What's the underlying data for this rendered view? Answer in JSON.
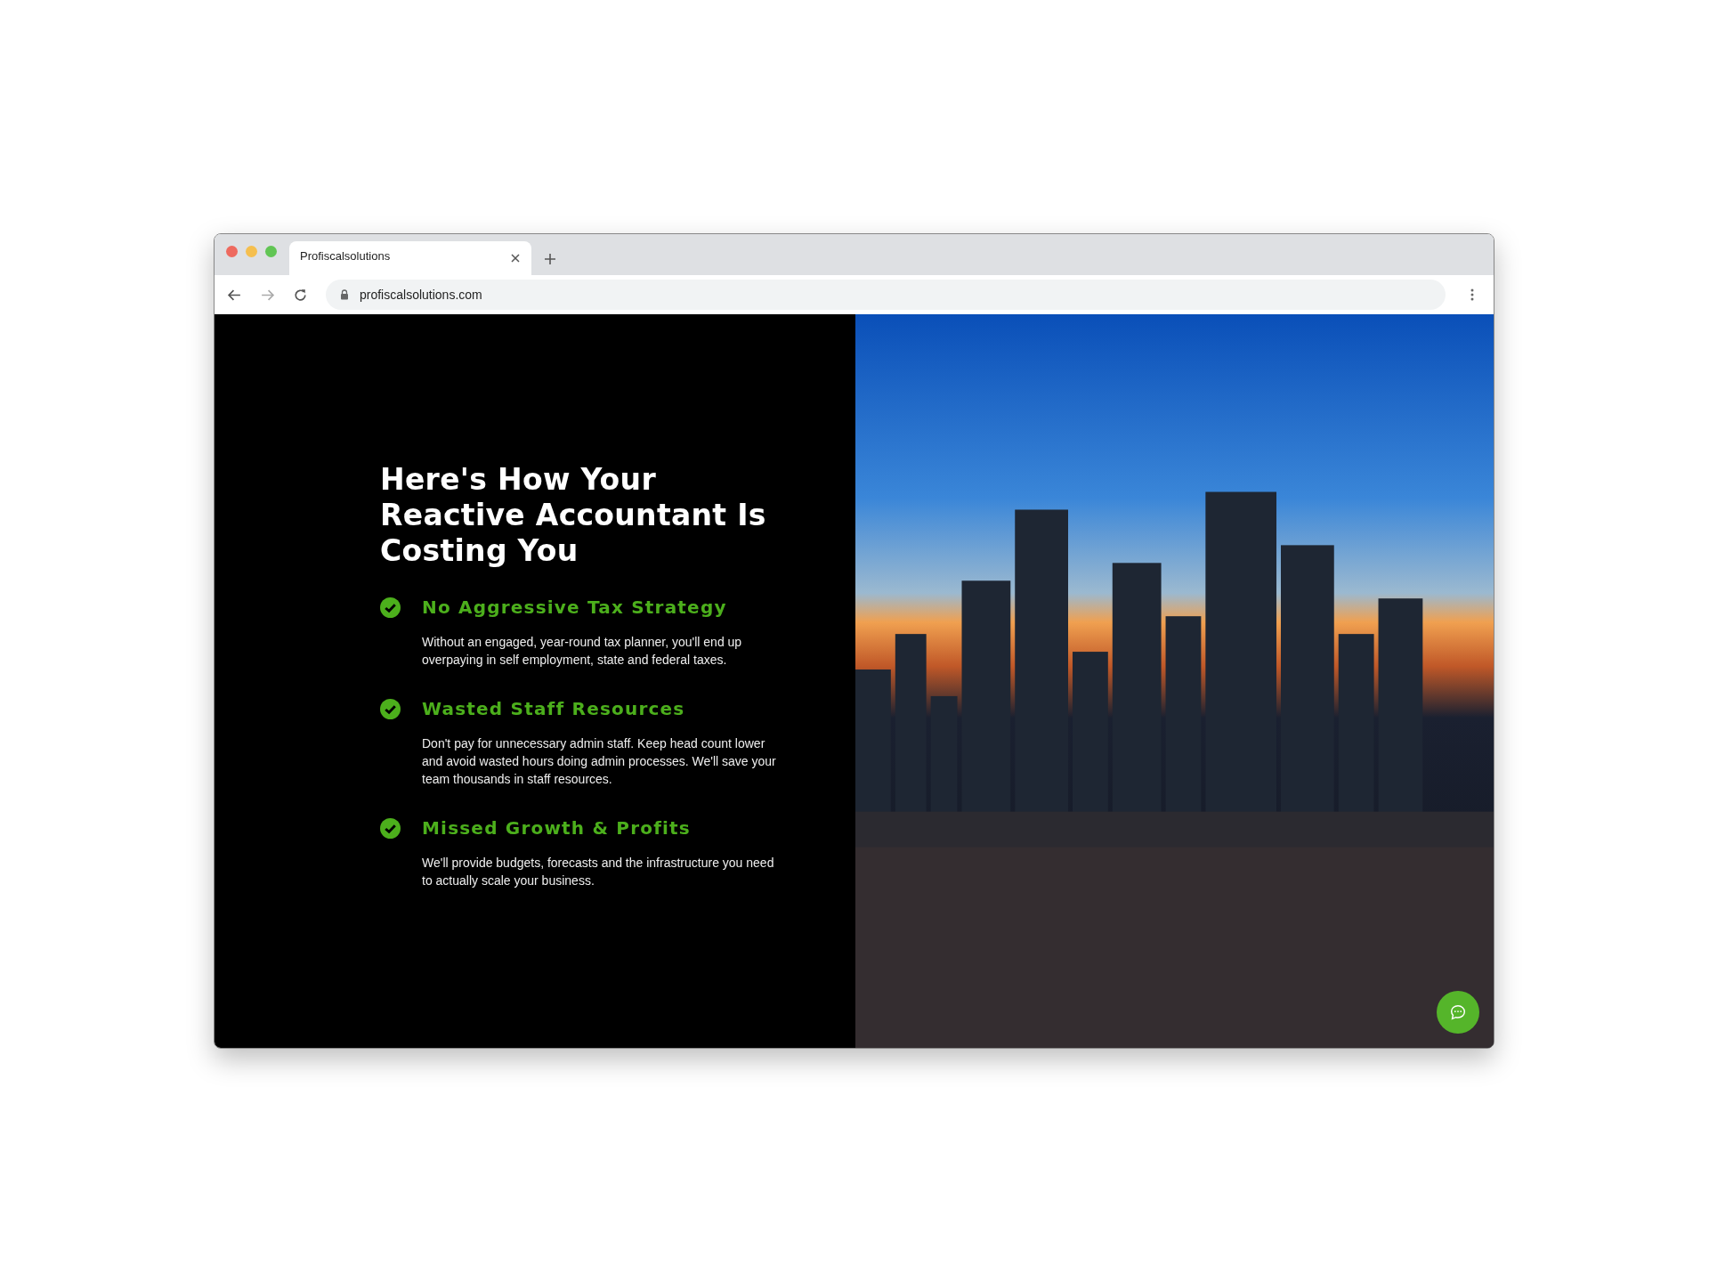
{
  "browser": {
    "tab_title": "Profiscalsolutions",
    "url": "profiscalsolutions.com"
  },
  "heading": "Here's How Your Reactive Accountant Is Costing You",
  "items": [
    {
      "title": "No Aggressive Tax Strategy",
      "text": "Without an engaged, year-round tax planner, you'll end up overpaying in self employment, state and federal taxes."
    },
    {
      "title": "Wasted Staff Resources",
      "text": "Don't pay for unnecessary admin staff. Keep head count lower and avoid wasted hours doing admin processes. We'll save your team thousands in staff resources."
    },
    {
      "title": "Missed Growth & Profits",
      "text": "We'll provide budgets, forecasts and the infrastructure you need to actually scale your business."
    }
  ]
}
